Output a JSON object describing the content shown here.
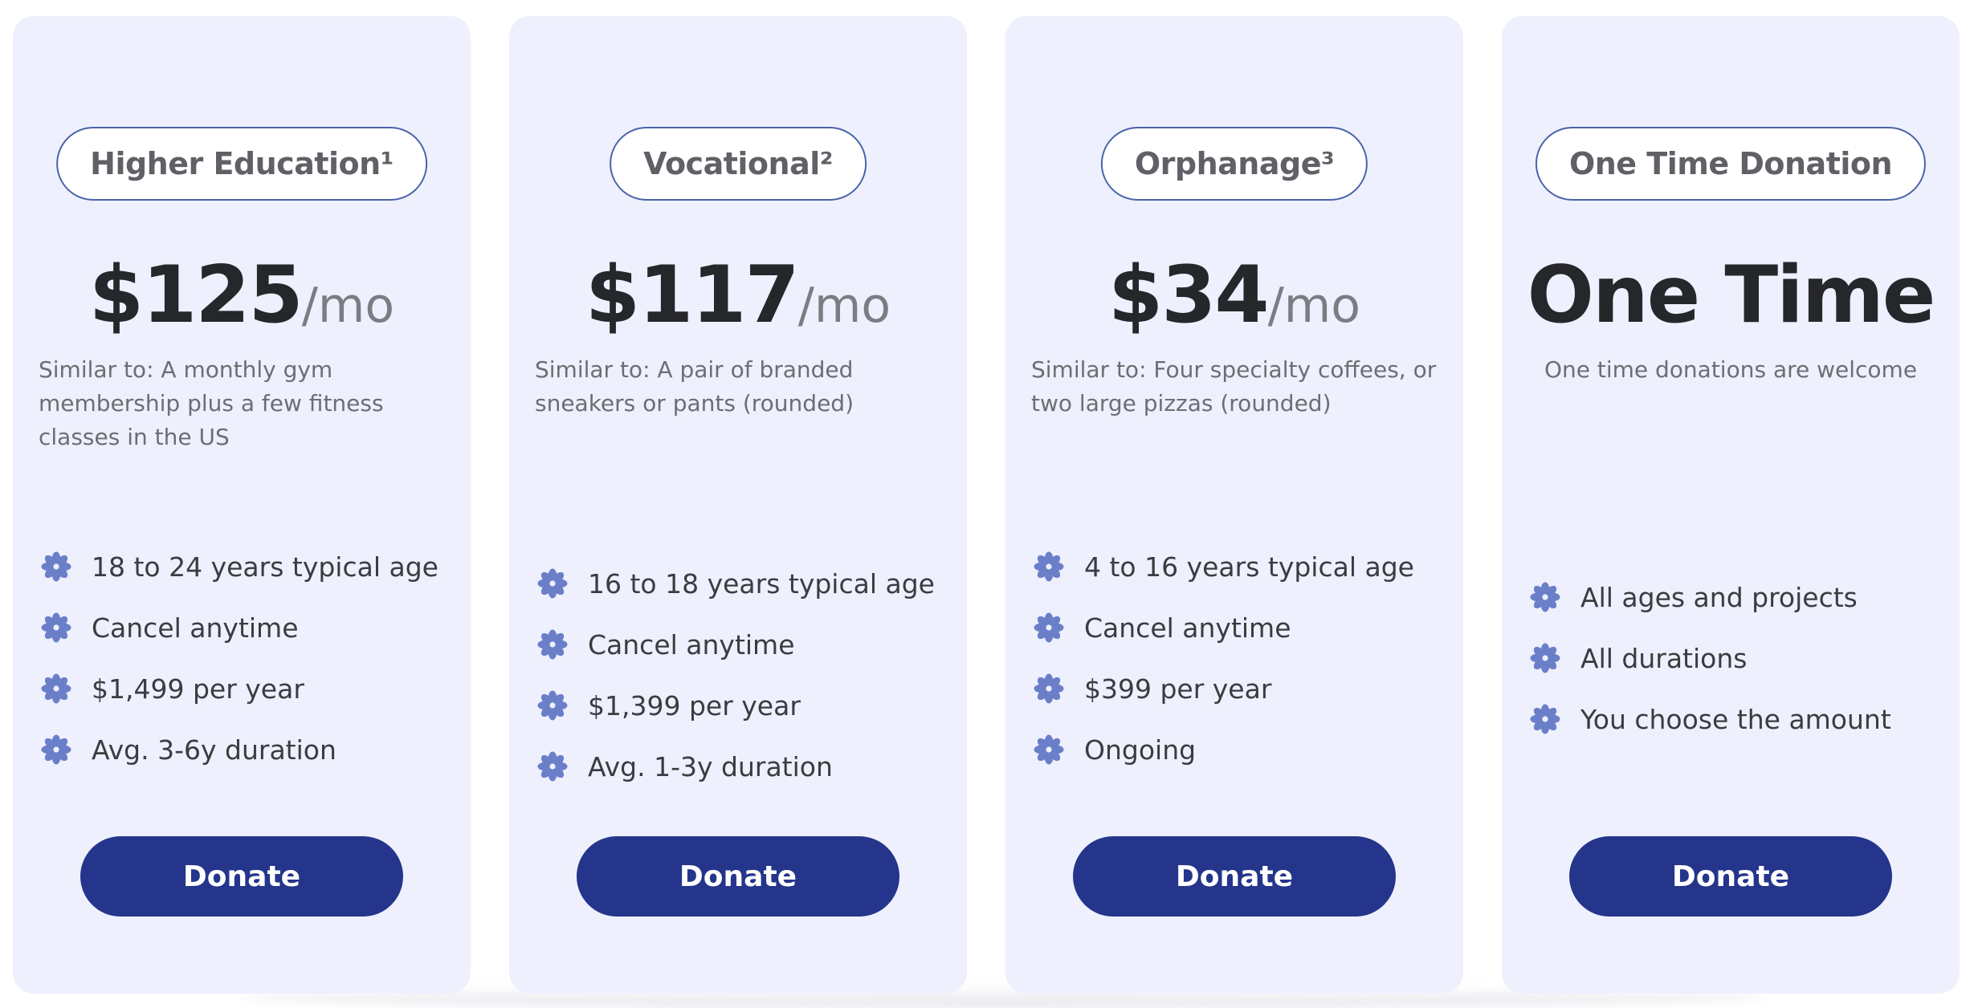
{
  "colors": {
    "card_background": "#eef0fd",
    "button": "#25358b",
    "icon": "#6b7fc9",
    "pill_border": "#4a63a8"
  },
  "feature_icon": "flower-icon",
  "plans": [
    {
      "name": "Higher Education¹",
      "price": "$125",
      "period": "/mo",
      "similar": "Similar to: A monthly gym membership plus a few fitness classes in the US",
      "features": [
        "18 to 24 years typical age",
        "Cancel anytime",
        "$1,499 per year",
        "Avg. 3-6y duration"
      ],
      "button": "Donate"
    },
    {
      "name": "Vocational²",
      "price": "$117",
      "period": "/mo",
      "similar": "Similar to: A pair of branded sneakers or pants (rounded)",
      "features": [
        "16 to 18 years typical age",
        "Cancel anytime",
        "$1,399 per year",
        "Avg. 1-3y duration"
      ],
      "button": "Donate"
    },
    {
      "name": "Orphanage³",
      "price": "$34",
      "period": "/mo",
      "similar": "Similar to: Four specialty coffees, or two large pizzas (rounded)",
      "features": [
        "4 to 16 years typical age",
        "Cancel anytime",
        "$399 per year",
        "Ongoing"
      ],
      "button": "Donate"
    },
    {
      "name": "One Time Donation",
      "price": "One Time",
      "period": "",
      "similar": "One time donations are welcome",
      "features": [
        "All ages and projects",
        "All durations",
        "You choose the amount"
      ],
      "button": "Donate"
    }
  ]
}
